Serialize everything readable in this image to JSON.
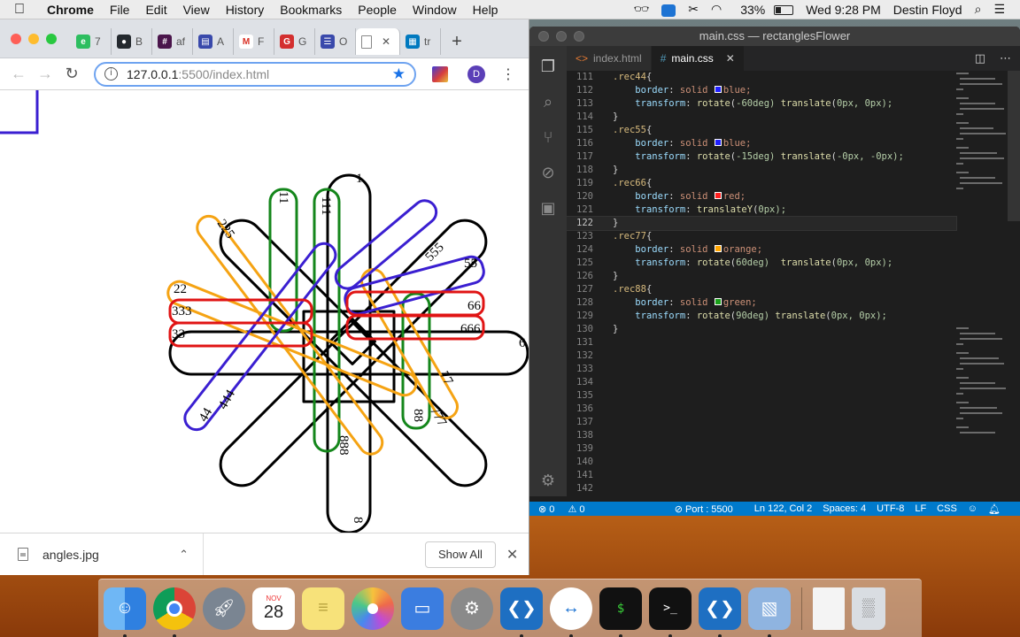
{
  "menubar": {
    "app_name": "Chrome",
    "menus": [
      "File",
      "Edit",
      "View",
      "History",
      "Bookmarks",
      "People",
      "Window",
      "Help"
    ],
    "battery": "33%",
    "clock": "Wed 9:28 PM",
    "user": "Destin Floyd"
  },
  "chrome": {
    "tabs": [
      {
        "label": "7",
        "icon": "evernote-icon",
        "color": "#2dbe60"
      },
      {
        "label": "B",
        "icon": "github-icon",
        "color": "#24292e"
      },
      {
        "label": "af",
        "icon": "slack-icon",
        "color": "#4a154b"
      },
      {
        "label": "A",
        "icon": "calendar-icon",
        "color": "#3949ab"
      },
      {
        "label": "F",
        "icon": "gmail-icon",
        "color": "#d93025"
      },
      {
        "label": "G",
        "icon": "ga-icon",
        "color": "#d32f2f"
      },
      {
        "label": "O",
        "icon": "list-icon",
        "color": "#3949ab"
      },
      {
        "label": "",
        "icon": "page-icon",
        "color": "#888888"
      },
      {
        "label": "tr",
        "icon": "trello-icon",
        "color": "#0079bf"
      }
    ],
    "url_host": "127.0.0.1",
    "url_rest": ":5500/index.html",
    "profile_initial": "D",
    "download_file": "angles.jpg",
    "show_all": "Show All"
  },
  "canvas_labels": {
    "l1": "1",
    "l11": "11",
    "l111": "111",
    "l22": "22",
    "l33": "33",
    "l333": "333",
    "l44": "44",
    "l444": "444",
    "l55": "55",
    "l555": "555",
    "l66": "66",
    "l666": "666",
    "l77": "77",
    "l777": "777",
    "l88": "88",
    "l888": "888",
    "l8": "8",
    "l6": "6",
    "l225": "225"
  },
  "vscode": {
    "title": "main.css — rectanglesFlower",
    "tabs": [
      {
        "label": "index.html",
        "icon": "html-icon"
      },
      {
        "label": "main.css",
        "icon": "css-icon"
      }
    ],
    "code": [
      {
        "n": "111",
        "text": ".rec44{"
      },
      {
        "n": "112",
        "text": "    border: solid blue;",
        "swatch": "#2020ff"
      },
      {
        "n": "113",
        "text": "    transform: rotate(-60deg) translate(0px, 0px);"
      },
      {
        "n": "114",
        "text": "}"
      },
      {
        "n": "115",
        "text": ".rec55{"
      },
      {
        "n": "116",
        "text": "    border: solid blue;",
        "swatch": "#2020ff"
      },
      {
        "n": "117",
        "text": "    transform: rotate(-15deg) translate(-0px, -0px);"
      },
      {
        "n": "118",
        "text": "}"
      },
      {
        "n": "119",
        "text": ".rec66{"
      },
      {
        "n": "120",
        "text": "    border: solid red;",
        "swatch": "#ff2020"
      },
      {
        "n": "121",
        "text": "    transform: translateY(0px);"
      },
      {
        "n": "122",
        "text": "}",
        "current": true
      },
      {
        "n": "123",
        "text": ".rec77{"
      },
      {
        "n": "124",
        "text": "    border: solid orange;",
        "swatch": "#ffa500"
      },
      {
        "n": "125",
        "text": "    transform: rotate(60deg)  translate(0px, 0px);"
      },
      {
        "n": "126",
        "text": "}"
      },
      {
        "n": "127",
        "text": ".rec88{"
      },
      {
        "n": "128",
        "text": "    border: solid green;",
        "swatch": "#1aa01a"
      },
      {
        "n": "129",
        "text": "    transform: rotate(90deg) translate(0px, 0px);"
      },
      {
        "n": "130",
        "text": "}"
      },
      {
        "n": "131",
        "text": ""
      },
      {
        "n": "132",
        "text": ""
      },
      {
        "n": "133",
        "text": ""
      },
      {
        "n": "134",
        "text": ""
      },
      {
        "n": "135",
        "text": ""
      },
      {
        "n": "136",
        "text": ""
      },
      {
        "n": "137",
        "text": ""
      },
      {
        "n": "138",
        "text": ""
      },
      {
        "n": "139",
        "text": ""
      },
      {
        "n": "140",
        "text": ""
      },
      {
        "n": "141",
        "text": ""
      },
      {
        "n": "142",
        "text": ""
      }
    ],
    "status": {
      "errors": "0",
      "warnings": "0",
      "port": "Port : 5500",
      "position": "Ln 122, Col 2",
      "spaces": "Spaces: 4",
      "encoding": "UTF-8",
      "eol": "LF",
      "language": "CSS"
    }
  },
  "dock": {
    "apps": [
      {
        "name": "Finder",
        "icon": "finder-icon",
        "color": "#4a9ef0"
      },
      {
        "name": "Chrome",
        "icon": "chrome-icon",
        "color": "#ffffff"
      },
      {
        "name": "Launchpad",
        "icon": "rocket-icon",
        "color": "#7a8592"
      },
      {
        "name": "Calendar",
        "icon": "calendar-icon",
        "color": "#ffffff"
      },
      {
        "name": "Notes",
        "icon": "notes-icon",
        "color": "#f7e27a"
      },
      {
        "name": "Photos",
        "icon": "photos-icon",
        "color": "#ffffff"
      },
      {
        "name": "Keynote",
        "icon": "keynote-icon",
        "color": "#3b7de0"
      },
      {
        "name": "System Preferences",
        "icon": "gear-icon",
        "color": "#8a8a8a"
      },
      {
        "name": "VS Code",
        "icon": "vscode-icon",
        "color": "#1e6fc2"
      },
      {
        "name": "TeamViewer",
        "icon": "teamviewer-icon",
        "color": "#ffffff"
      },
      {
        "name": "Terminal",
        "icon": "terminal-icon",
        "color": "#111111"
      },
      {
        "name": "Terminal 2",
        "icon": "terminal-icon",
        "color": "#111111"
      },
      {
        "name": "VS Code 2",
        "icon": "vscode-icon",
        "color": "#1e6fc2"
      },
      {
        "name": "Preview",
        "icon": "preview-icon",
        "color": "#8fb4e0"
      },
      {
        "name": "Document",
        "icon": "document-icon",
        "color": "#f4f4f4"
      },
      {
        "name": "Trash",
        "icon": "trash-icon",
        "color": "#d9dde2"
      }
    ],
    "calendar_month": "NOV",
    "calendar_day": "28",
    "terminal_prompt": "$",
    "terminal_prompt2": ">_"
  }
}
